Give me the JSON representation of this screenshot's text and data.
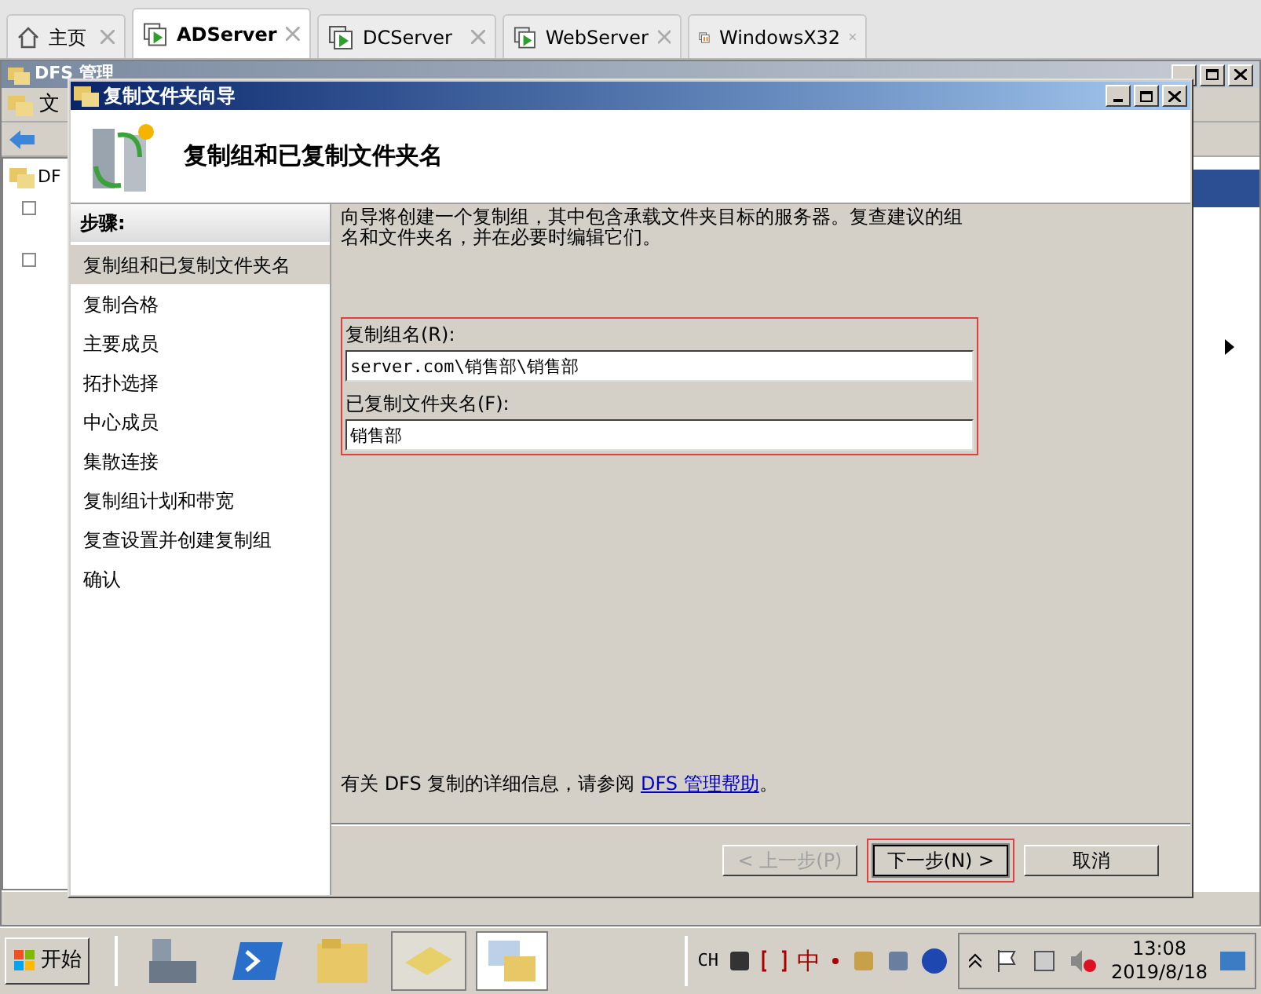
{
  "browser_tabs": [
    {
      "label": "主页",
      "selected": false,
      "kind": "home"
    },
    {
      "label": "ADServer",
      "selected": true,
      "kind": "vm"
    },
    {
      "label": "DCServer",
      "selected": false,
      "kind": "vm"
    },
    {
      "label": "WebServer",
      "selected": false,
      "kind": "vm"
    },
    {
      "label": "WindowsX32",
      "selected": false,
      "kind": "vm-paused"
    }
  ],
  "background_window": {
    "title": "DFS 管理",
    "menu": "文",
    "tree_item": "DF"
  },
  "dialog": {
    "title": "复制文件夹向导",
    "heading": "复制组和已复制文件夹名",
    "steps_title": "步骤:",
    "steps": [
      {
        "label": "复制组和已复制文件夹名",
        "selected": true
      },
      {
        "label": "复制合格",
        "selected": false
      },
      {
        "label": "主要成员",
        "selected": false
      },
      {
        "label": "拓扑选择",
        "selected": false
      },
      {
        "label": "中心成员",
        "selected": false
      },
      {
        "label": "集散连接",
        "selected": false
      },
      {
        "label": "复制组计划和带宽",
        "selected": false
      },
      {
        "label": "复查设置并创建复制组",
        "selected": false
      },
      {
        "label": "确认",
        "selected": false
      }
    ],
    "description": "向导将创建一个复制组，其中包含承载文件夹目标的服务器。复查建议的组名和文件夹名，并在必要时编辑它们。",
    "fields": [
      {
        "label": "复制组名(R):",
        "value": "server.com\\销售部\\销售部"
      },
      {
        "label": "已复制文件夹名(F):",
        "value": "销售部"
      }
    ],
    "help_text": "有关 DFS 复制的详细信息，请参阅 ",
    "help_link": "DFS 管理帮助",
    "help_suffix": "。",
    "buttons": [
      {
        "label": "< 上一步(P)",
        "disabled": true,
        "default": false
      },
      {
        "label": "下一步(N) >",
        "disabled": false,
        "default": true
      },
      {
        "label": "取消",
        "disabled": false,
        "default": false
      }
    ]
  },
  "taskbar": {
    "start": "开始",
    "language": "CH",
    "ime": "中",
    "time": "13:08",
    "date": "2019/8/18"
  }
}
